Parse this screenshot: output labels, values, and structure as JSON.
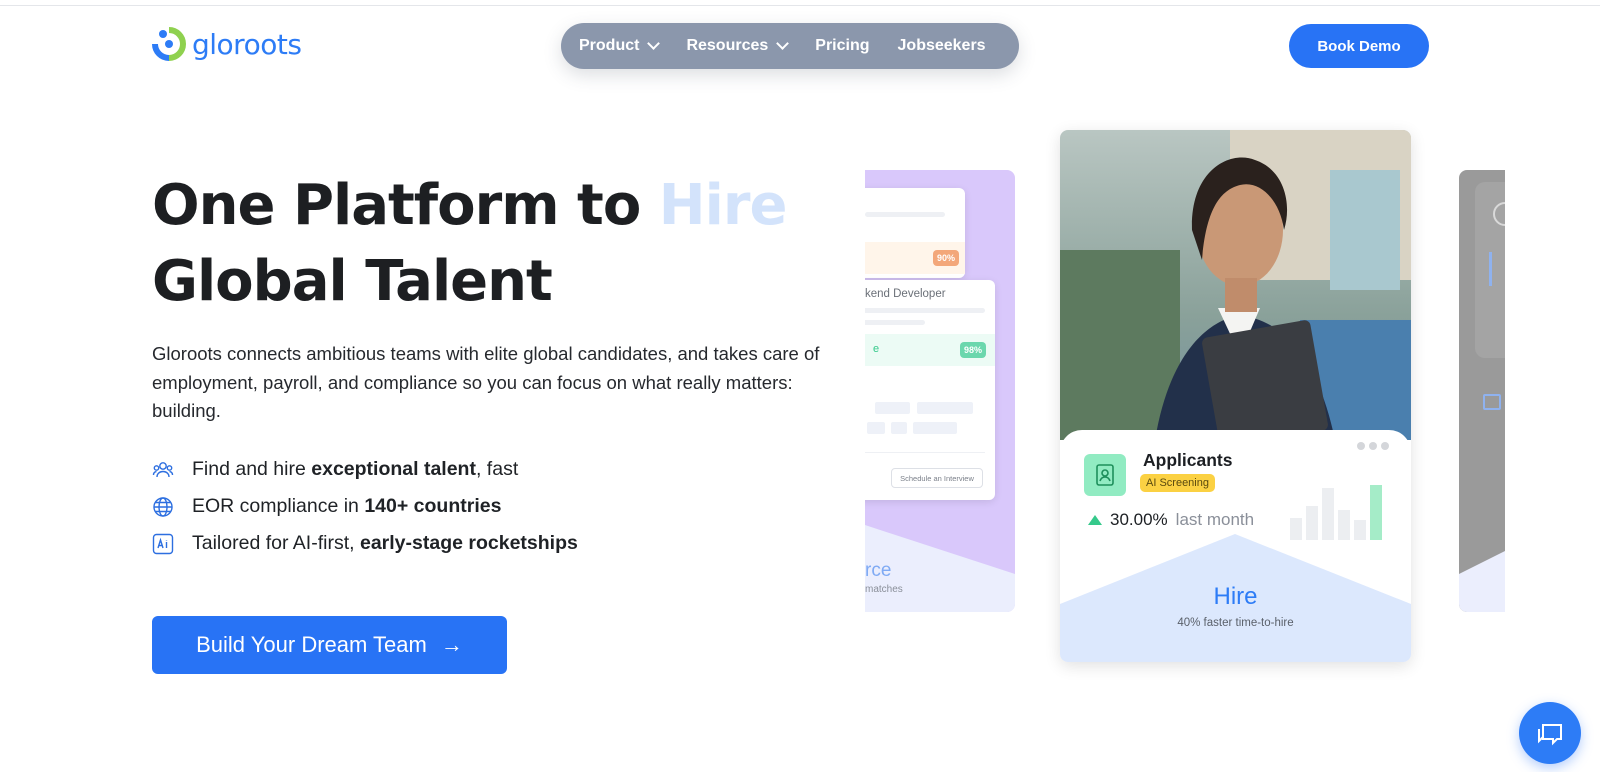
{
  "header": {
    "logo_text": "gloroots",
    "nav": [
      {
        "label": "Product",
        "has_dropdown": true
      },
      {
        "label": "Resources",
        "has_dropdown": true
      },
      {
        "label": "Pricing",
        "has_dropdown": false
      },
      {
        "label": "Jobseekers",
        "has_dropdown": false
      }
    ],
    "book_demo_label": "Book Demo"
  },
  "hero": {
    "title_part1": "One Platform to ",
    "title_highlight": "Hire",
    "title_part2": "Global Talent",
    "description": "Gloroots connects ambitious teams with elite global candidates, and takes care of employment, payroll, and compliance so you can focus on what really matters: building.",
    "features": [
      {
        "icon": "people-icon",
        "pre": "Find and hire ",
        "bold": "exceptional talent",
        "post": ", fast"
      },
      {
        "icon": "globe-icon",
        "pre": "EOR compliance in ",
        "bold": "140+ countries",
        "post": ""
      },
      {
        "icon": "ai-icon",
        "pre": "Tailored for AI-first, ",
        "bold": "early-stage rocketships",
        "post": ""
      }
    ],
    "cta_label": "Build Your Dream Team",
    "cta_arrow": "→"
  },
  "carousel": {
    "left_card": {
      "pct_top": "90%",
      "role": "kend Developer",
      "pct_mid": "98%",
      "mid_fragment": "e",
      "schedule_label": "Schedule an Interview",
      "section_title": "rce",
      "section_sub": "matches",
      "accent": "#d9c8fb"
    },
    "main_card": {
      "title": "Applicants",
      "badge": "AI Screening",
      "stat_value": "30.00%",
      "stat_period": "last month",
      "section_title": "Hire",
      "section_sub": "40% faster time-to-hire",
      "trend": "up",
      "accent": "#2d7cf6"
    }
  },
  "colors": {
    "brand_blue": "#2873f5",
    "nav_bg": "#8b97ac",
    "highlight": "#d3e3fb",
    "success_green": "#35c98b",
    "badge_yellow": "#fbd143"
  },
  "chat_icon": "chat-bubbles-icon"
}
